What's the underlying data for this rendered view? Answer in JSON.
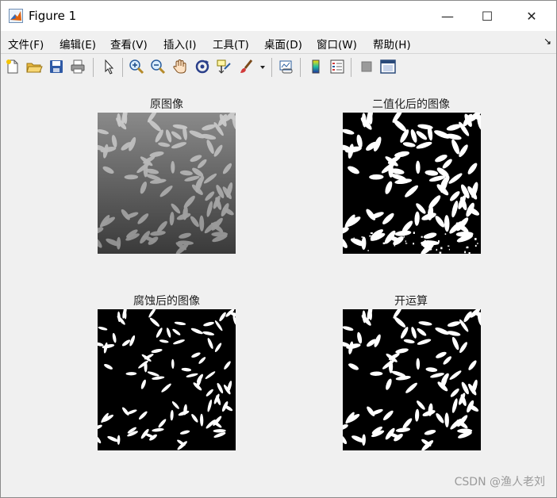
{
  "window": {
    "title": "Figure 1",
    "minimize": "—",
    "maximize": "☐",
    "close": "✕"
  },
  "menu": [
    "文件(F)",
    "编辑(E)",
    "查看(V)",
    "插入(I)",
    "工具(T)",
    "桌面(D)",
    "窗口(W)",
    "帮助(H)"
  ],
  "menu_overflow": "↘",
  "toolbar": [
    "new-figure-icon",
    "open-file-icon",
    "save-icon",
    "print-icon",
    "select-arrow-icon",
    "zoom-in-icon",
    "zoom-out-icon",
    "pan-hand-icon",
    "rotate-3d-icon",
    "data-cursor-icon",
    "brush-icon",
    "brush-dropdown-icon",
    "link-plot-icon",
    "colorbar-icon",
    "legend-icon",
    "hide-plot-tools-icon",
    "show-plot-tools-icon"
  ],
  "subplots": [
    {
      "title": "原图像",
      "style": "gray"
    },
    {
      "title": "二值化后的图像",
      "style": "binary"
    },
    {
      "title": "腐蚀后的图像",
      "style": "eroded"
    },
    {
      "title": "开运算",
      "style": "opened"
    }
  ],
  "watermark": "CSDN @渔人老刘"
}
